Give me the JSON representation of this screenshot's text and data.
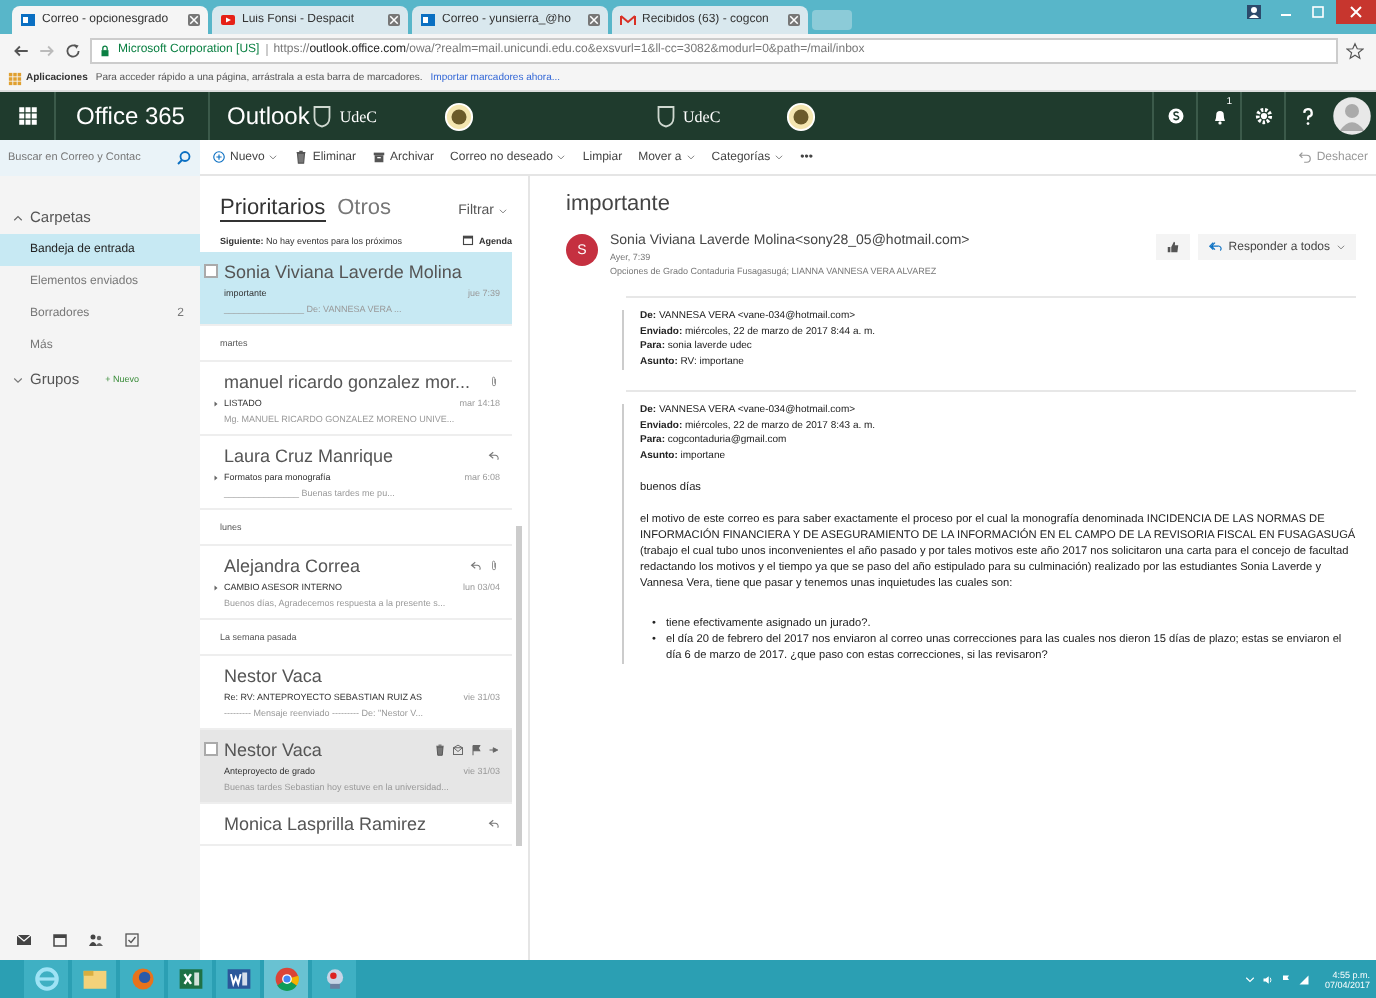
{
  "browser": {
    "tabs": [
      {
        "title": "Correo - opcionesgrado",
        "kind": "outlook",
        "selected": true
      },
      {
        "title": "Luis Fonsi - Despacit",
        "kind": "video",
        "selected": false
      },
      {
        "title": "Correo - yunsierra_@ho",
        "kind": "outlook",
        "selected": false
      },
      {
        "title": "Recibidos (63) - cogcon",
        "kind": "gmail",
        "selected": false
      }
    ],
    "address": {
      "security": "Microsoft Corporation [US]",
      "url": "https://**outlook.office.com**/owa/?realm=mail.unicundi.edu.co&exsvurl=1&ll-cc=3082&modurl=0&path=/mail/inbox"
    },
    "bookmarks": {
      "apps": "Aplicaciones",
      "hint": "Para acceder rápido a una página, arrástrala a esta barra de marcadores.",
      "link": "Importar marcadores ahora..."
    }
  },
  "header": {
    "suite": "Office 365",
    "app": "Outlook",
    "logos": [
      "UdeC",
      "UdeC"
    ],
    "notifications": "1"
  },
  "toolbar": {
    "search_placeholder": "Buscar en Correo y Contac",
    "actions": [
      {
        "label": "Nuevo",
        "kind": "new",
        "dropdown": true
      },
      {
        "label": "Eliminar",
        "kind": "delete",
        "dropdown": false
      },
      {
        "label": "Archivar",
        "kind": "archive",
        "dropdown": false
      },
      {
        "label": "Correo no deseado",
        "kind": "text",
        "dropdown": true
      },
      {
        "label": "Limpiar",
        "kind": "text",
        "dropdown": false
      },
      {
        "label": "Mover a",
        "kind": "text",
        "dropdown": true
      },
      {
        "label": "Categorías",
        "kind": "text",
        "dropdown": true
      },
      {
        "label": "•••",
        "kind": "text",
        "dropdown": false
      }
    ],
    "undo": "Deshacer"
  },
  "nav": {
    "sections": [
      {
        "label": "Carpetas",
        "expanded": true,
        "items": [
          {
            "label": "Bandeja de entrada",
            "selected": true
          },
          {
            "label": "Elementos enviados",
            "selected": false
          },
          {
            "label": "Borradores",
            "count": "2",
            "selected": false
          },
          {
            "label": "Más",
            "selected": false
          }
        ]
      },
      {
        "label": "Grupos",
        "expanded": false,
        "action": "+ Nuevo"
      }
    ]
  },
  "list": {
    "tabs": [
      {
        "label": "Prioritarios",
        "selected": true
      },
      {
        "label": "Otros",
        "selected": false
      }
    ],
    "filter": "Filtrar",
    "agenda_hint": "**Siguiente:** No hay eventos para los próximos",
    "agenda": "Agenda",
    "items": [
      {
        "kind": "message",
        "sender": "Sonia Viviana Laverde Molina",
        "subject": "importante",
        "date": "jue 7:39",
        "preview": "________________ De: VANNESA VERA ...",
        "selected": true,
        "hovered": false
      },
      {
        "kind": "group",
        "label": "martes"
      },
      {
        "kind": "message",
        "sender": "manuel ricardo gonzalez mor...",
        "subject": "LISTADO",
        "date": "mar 14:18",
        "preview": "Mg. MANUEL RICARDO GONZALEZ MORENO UNIVE...",
        "selected": false,
        "hovered": false,
        "attachment": true,
        "thread": true
      },
      {
        "kind": "message",
        "sender": "Laura Cruz Manrique",
        "subject": "Formatos para monografía",
        "date": "mar 6:08",
        "preview": "_______________ Buenas tardes me pu...",
        "selected": false,
        "hovered": false,
        "replied": true,
        "thread": true
      },
      {
        "kind": "group",
        "label": "lunes"
      },
      {
        "kind": "message",
        "sender": "Alejandra Correa",
        "subject": "CAMBIO ASESOR INTERNO",
        "date": "lun 03/04",
        "preview": "Buenos días, Agradecemos respuesta a la presente s...",
        "selected": false,
        "hovered": false,
        "replied": true,
        "attachment": true,
        "thread": true
      },
      {
        "kind": "group",
        "label": "La semana pasada"
      },
      {
        "kind": "message",
        "sender": "Nestor Vaca",
        "subject": "Re: RV: ANTEPROYECTO SEBASTIAN RUIZ AS",
        "date": "vie 31/03",
        "preview": "--------- Mensaje reenviado --------- De: \"Nestor V...",
        "selected": false,
        "hovered": false
      },
      {
        "kind": "message",
        "sender": "Nestor Vaca",
        "subject": "Anteproyecto de grado",
        "date": "vie 31/03",
        "preview": "Buenas tardes Sebastian hoy estuve en la universidad...",
        "selected": false,
        "hovered": true
      },
      {
        "kind": "message",
        "sender": "Monica Lasprilla Ramirez",
        "selected": false,
        "hovered": false,
        "replied": true
      }
    ]
  },
  "reading": {
    "subject": "importante",
    "avatar": "S",
    "sender": "Sonia Viviana Laverde Molina<sony28_05@hotmail.com>",
    "time": "Ayer, 7:39",
    "recipients": "Opciones de Grado Contaduria Fusagasugá; LIANNA VANNESA VERA ALVAREZ",
    "reply_all": "Responder a todos",
    "quotes": [
      {
        "fields": [
          {
            "label": "De:",
            "value": "VANNESA VERA <vane-034@hotmail.com>"
          },
          {
            "label": "Enviado:",
            "value": "miércoles, 22 de marzo de 2017 8:44 a. m."
          },
          {
            "label": "Para:",
            "value": "sonia laverde udec"
          },
          {
            "label": "Asunto:",
            "value": "RV: importane"
          }
        ]
      },
      {
        "fields": [
          {
            "label": "De:",
            "value": "VANNESA VERA <vane-034@hotmail.com>"
          },
          {
            "label": "Enviado:",
            "value": "miércoles, 22 de marzo de 2017 8:43 a. m."
          },
          {
            "label": "Para:",
            "value": "cogcontaduria@gmail.com"
          },
          {
            "label": "Asunto:",
            "value": "importane"
          }
        ],
        "body": [
          {
            "kind": "paragraph",
            "text": "buenos días"
          },
          {
            "kind": "paragraph",
            "text": "el motivo de este correo es para saber exactamente el proceso por el cual la monografía denominada INCIDENCIA DE LAS NORMAS DE INFORMACIÓN FINANCIERA Y DE ASEGURAMIENTO DE LA INFORMACIÓN EN EL CAMPO DE LA REVISORIA FISCAL EN FUSAGASUGÁ (trabajo el cual tubo unos inconvenientes el año pasado y por tales motivos este año 2017 nos solicitaron una carta para el concejo de facultad redactando los motivos y el tiempo ya que se paso del año estipulado para su culminación)  realizado por las estudiantes Sonia Laverde y Vannesa Vera,  tiene que pasar y  tenemos unas inquietudes las cuales son:"
          },
          {
            "kind": "bullets",
            "marker": "•",
            "items": [
              "tiene efectivamente asignado un jurado?.",
              "el día 20 de febrero del 2017 nos enviaron al correo unas correcciones para las cuales nos dieron 15 días de plazo; estas se enviaron el día 6 de marzo de 2017. ¿que paso con estas correcciones, si las revisaron?"
            ]
          }
        ]
      }
    ]
  },
  "taskbar": {
    "apps": [
      {
        "kind": "ie",
        "active": false
      },
      {
        "kind": "explorer",
        "active": false
      },
      {
        "kind": "firefox",
        "active": false
      },
      {
        "kind": "excel",
        "active": false
      },
      {
        "kind": "word",
        "active": false
      },
      {
        "kind": "chrome",
        "active": true
      },
      {
        "kind": "other",
        "active": false
      }
    ],
    "time": "4:55 p.m.",
    "date": "07/04/2017"
  }
}
